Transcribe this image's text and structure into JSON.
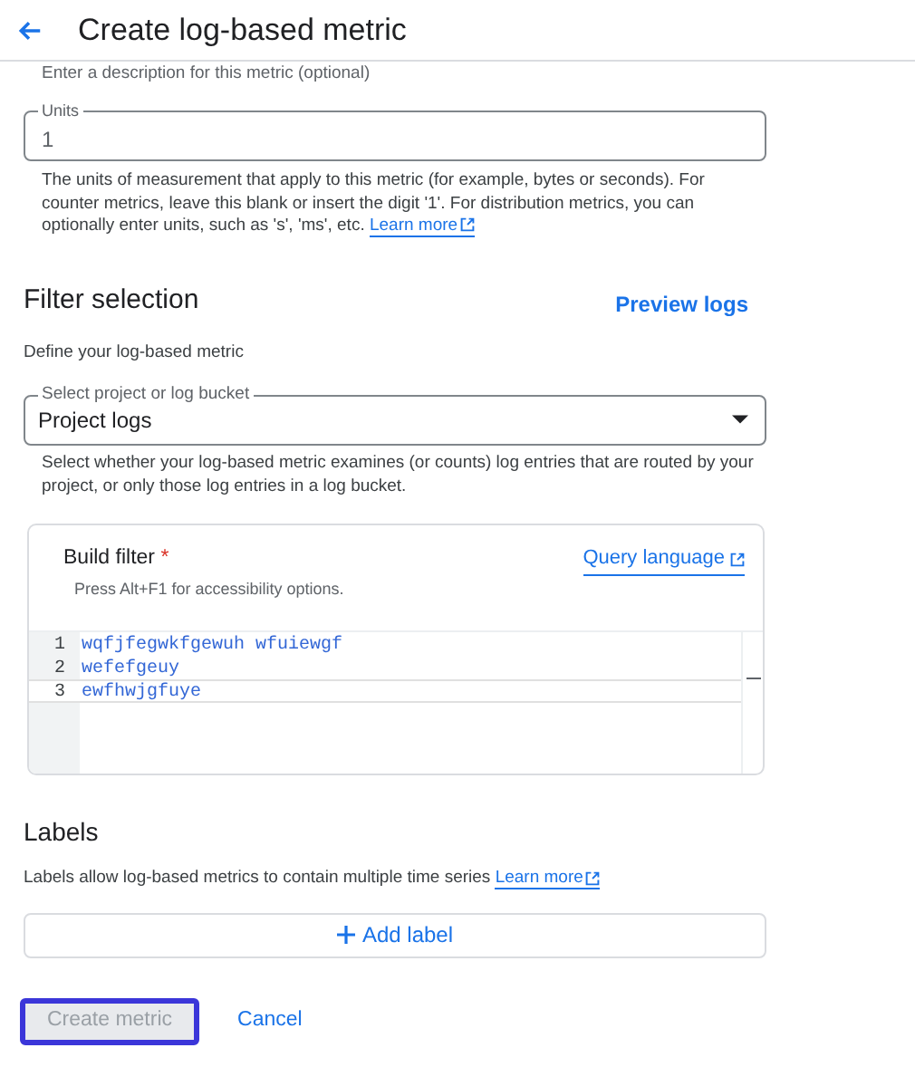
{
  "header": {
    "title": "Create log-based metric"
  },
  "description_hint": "Enter a description for this metric (optional)",
  "units": {
    "label": "Units",
    "value": "1",
    "help": "The units of measurement that apply to this metric (for example, bytes or seconds). For counter metrics, leave this blank or insert the digit '1'. For distribution metrics, you can optionally enter units, such as 's', 'ms', etc.",
    "link": "Learn more"
  },
  "filter_selection": {
    "heading": "Filter selection",
    "action": "Preview logs",
    "subtitle": "Define your log-based metric",
    "select": {
      "label": "Select project or log bucket",
      "value": "Project logs",
      "help": "Select whether your log-based metric examines (or counts) log entries that are routed by your project, or only those log entries in a log bucket."
    },
    "build_filter": {
      "title": "Build filter",
      "required_mark": "*",
      "link": "Query language",
      "hint": "Press Alt+F1 for accessibility options.",
      "lines": [
        {
          "number": "1",
          "text": "wqfjfegwkfgewuh wfuiewgf",
          "selected": false
        },
        {
          "number": "2",
          "text": "wefefgeuy",
          "selected": false
        },
        {
          "number": "3",
          "text": "ewfhwjgfuye",
          "selected": true
        }
      ]
    }
  },
  "labels": {
    "heading": "Labels",
    "text": "Labels allow log-based metrics to contain multiple time series",
    "link": "Learn more",
    "add_button": "Add label"
  },
  "actions": [
    {
      "kind": "primary",
      "label": "Create metric",
      "disabled": true,
      "focused": true
    },
    {
      "kind": "text",
      "label": "Cancel",
      "disabled": false,
      "focused": false
    }
  ]
}
